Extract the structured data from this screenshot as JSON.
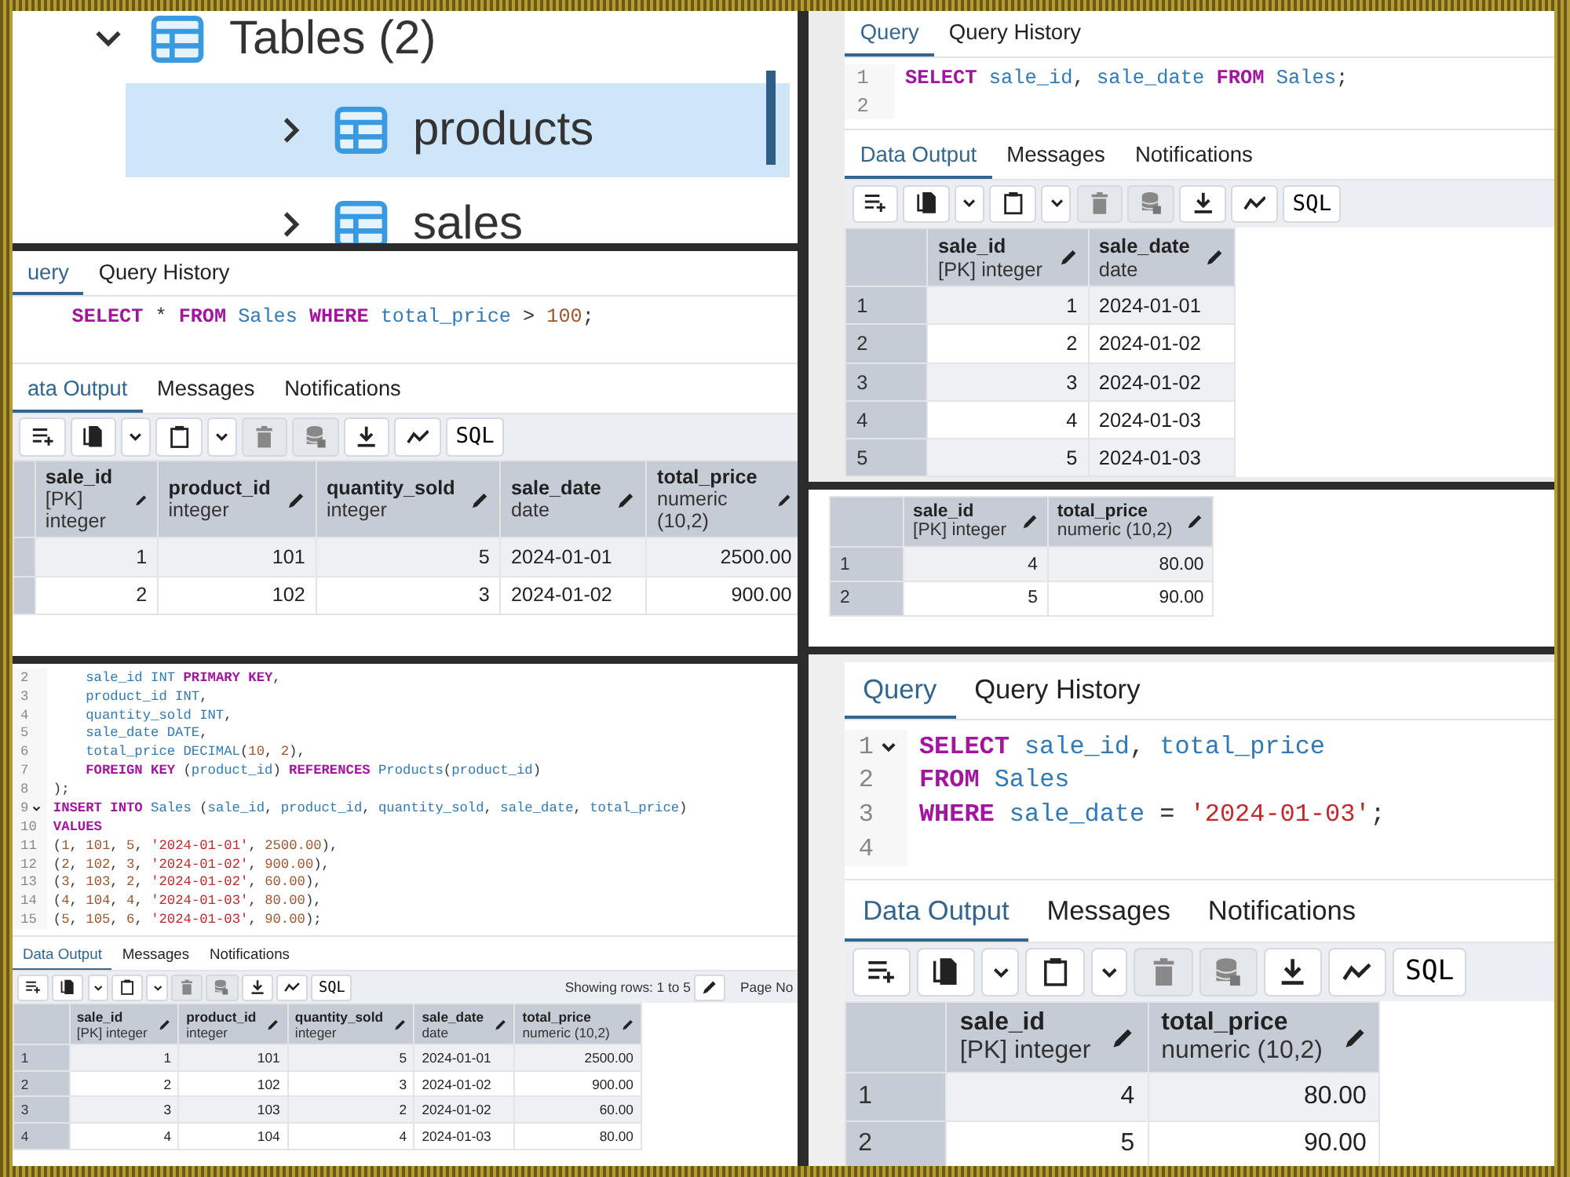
{
  "left_column": {
    "panels": [
      {
        "kind": "tree",
        "nodes": [
          {
            "label": "Tables (2)",
            "expanded": true,
            "selected": false,
            "children": [
              {
                "label": "products",
                "expanded": false,
                "selected": true
              },
              {
                "label": "sales",
                "expanded": false,
                "selected": false
              }
            ]
          }
        ]
      },
      {
        "kind": "query",
        "editor_tabs": [
          {
            "label": "uery",
            "selected": true
          },
          {
            "label": "Query History",
            "selected": false
          }
        ],
        "code": [
          {
            "tokens": [
              {
                "kind": "keyword",
                "text": "SELECT "
              },
              {
                "kind": "plain",
                "text": "* "
              },
              {
                "kind": "keyword",
                "text": "FROM "
              },
              {
                "kind": "name",
                "text": "Sales "
              },
              {
                "kind": "keyword",
                "text": "WHERE "
              },
              {
                "kind": "name",
                "text": "total_price "
              },
              {
                "kind": "plain",
                "text": "> "
              },
              {
                "kind": "number",
                "text": "100"
              },
              {
                "kind": "plain",
                "text": ";"
              }
            ]
          }
        ],
        "output_tabs": [
          {
            "label": "ata Output",
            "selected": true
          },
          {
            "label": "Messages",
            "selected": false
          },
          {
            "label": "Notifications",
            "selected": false
          }
        ],
        "toolbar": [
          {
            "kind": "add-row",
            "disabled": false
          },
          {
            "kind": "copy",
            "disabled": false
          },
          {
            "kind": "menu",
            "disabled": false
          },
          {
            "kind": "paste",
            "disabled": false
          },
          {
            "kind": "menu",
            "disabled": false
          },
          {
            "kind": "delete",
            "disabled": true
          },
          {
            "kind": "save",
            "disabled": true
          },
          {
            "kind": "download",
            "disabled": false
          },
          {
            "kind": "graph",
            "disabled": false
          },
          {
            "kind": "sql",
            "label": "SQL",
            "disabled": false
          }
        ],
        "table": {
          "columns": [
            {
              "name": "sale_id",
              "type": "[PK] integer",
              "right_aligned": true
            },
            {
              "name": "product_id",
              "type": "integer",
              "right_aligned": true
            },
            {
              "name": "quantity_sold",
              "type": "integer",
              "right_aligned": true
            },
            {
              "name": "sale_date",
              "type": "date",
              "right_aligned": false
            },
            {
              "name": "total_price",
              "type": "numeric (10,2)",
              "right_aligned": true
            }
          ],
          "rows": [
            {
              "cells": [
                "1",
                "101",
                "5",
                "2024-01-01",
                "2500.00"
              ]
            },
            {
              "cells": [
                "2",
                "102",
                "3",
                "2024-01-02",
                "900.00"
              ]
            }
          ]
        }
      },
      {
        "kind": "query",
        "code": [
          {
            "number": "2",
            "fold": false,
            "indent": true,
            "tokens": [
              {
                "kind": "name",
                "text": "sale_id INT "
              },
              {
                "kind": "keyword",
                "text": "PRIMARY KEY"
              },
              {
                "kind": "plain",
                "text": ","
              }
            ]
          },
          {
            "number": "3",
            "fold": false,
            "indent": true,
            "tokens": [
              {
                "kind": "name",
                "text": "product_id INT"
              },
              {
                "kind": "plain",
                "text": ","
              }
            ]
          },
          {
            "number": "4",
            "fold": false,
            "indent": true,
            "tokens": [
              {
                "kind": "name",
                "text": "quantity_sold INT"
              },
              {
                "kind": "plain",
                "text": ","
              }
            ]
          },
          {
            "number": "5",
            "fold": false,
            "indent": true,
            "tokens": [
              {
                "kind": "name",
                "text": "sale_date DATE"
              },
              {
                "kind": "plain",
                "text": ","
              }
            ]
          },
          {
            "number": "6",
            "fold": false,
            "indent": true,
            "tokens": [
              {
                "kind": "name",
                "text": "total_price DECIMAL"
              },
              {
                "kind": "plain",
                "text": "("
              },
              {
                "kind": "number",
                "text": "10"
              },
              {
                "kind": "plain",
                "text": ", "
              },
              {
                "kind": "number",
                "text": "2"
              },
              {
                "kind": "plain",
                "text": "),"
              }
            ]
          },
          {
            "number": "7",
            "fold": false,
            "indent": true,
            "tokens": [
              {
                "kind": "keyword",
                "text": "FOREIGN KEY "
              },
              {
                "kind": "plain",
                "text": "("
              },
              {
                "kind": "name",
                "text": "product_id"
              },
              {
                "kind": "plain",
                "text": ") "
              },
              {
                "kind": "keyword",
                "text": "REFERENCES "
              },
              {
                "kind": "name",
                "text": "Products"
              },
              {
                "kind": "plain",
                "text": "("
              },
              {
                "kind": "name",
                "text": "product_id"
              },
              {
                "kind": "plain",
                "text": ")"
              }
            ]
          },
          {
            "number": "8",
            "fold": false,
            "indent": false,
            "tokens": [
              {
                "kind": "plain",
                "text": ");"
              }
            ]
          },
          {
            "number": "9",
            "fold": true,
            "indent": false,
            "tokens": [
              {
                "kind": "keyword",
                "text": "INSERT INTO "
              },
              {
                "kind": "name",
                "text": "Sales "
              },
              {
                "kind": "plain",
                "text": "("
              },
              {
                "kind": "name",
                "text": "sale_id"
              },
              {
                "kind": "plain",
                "text": ", "
              },
              {
                "kind": "name",
                "text": "product_id"
              },
              {
                "kind": "plain",
                "text": ", "
              },
              {
                "kind": "name",
                "text": "quantity_sold"
              },
              {
                "kind": "plain",
                "text": ", "
              },
              {
                "kind": "name",
                "text": "sale_date"
              },
              {
                "kind": "plain",
                "text": ", "
              },
              {
                "kind": "name",
                "text": "total_price"
              },
              {
                "kind": "plain",
                "text": ")"
              }
            ]
          },
          {
            "number": "10",
            "fold": false,
            "indent": false,
            "tokens": [
              {
                "kind": "keyword",
                "text": "VALUES"
              }
            ]
          },
          {
            "number": "11",
            "fold": false,
            "indent": false,
            "tokens": [
              {
                "kind": "plain",
                "text": "("
              },
              {
                "kind": "number",
                "text": "1"
              },
              {
                "kind": "plain",
                "text": ", "
              },
              {
                "kind": "number",
                "text": "101"
              },
              {
                "kind": "plain",
                "text": ", "
              },
              {
                "kind": "number",
                "text": "5"
              },
              {
                "kind": "plain",
                "text": ", "
              },
              {
                "kind": "string",
                "text": "'2024-01-01'"
              },
              {
                "kind": "plain",
                "text": ", "
              },
              {
                "kind": "number",
                "text": "2500.00"
              },
              {
                "kind": "plain",
                "text": "),"
              }
            ]
          },
          {
            "number": "12",
            "fold": false,
            "indent": false,
            "tokens": [
              {
                "kind": "plain",
                "text": "("
              },
              {
                "kind": "number",
                "text": "2"
              },
              {
                "kind": "plain",
                "text": ", "
              },
              {
                "kind": "number",
                "text": "102"
              },
              {
                "kind": "plain",
                "text": ", "
              },
              {
                "kind": "number",
                "text": "3"
              },
              {
                "kind": "plain",
                "text": ", "
              },
              {
                "kind": "string",
                "text": "'2024-01-02'"
              },
              {
                "kind": "plain",
                "text": ", "
              },
              {
                "kind": "number",
                "text": "900.00"
              },
              {
                "kind": "plain",
                "text": "),"
              }
            ]
          },
          {
            "number": "13",
            "fold": false,
            "indent": false,
            "tokens": [
              {
                "kind": "plain",
                "text": "("
              },
              {
                "kind": "number",
                "text": "3"
              },
              {
                "kind": "plain",
                "text": ", "
              },
              {
                "kind": "number",
                "text": "103"
              },
              {
                "kind": "plain",
                "text": ", "
              },
              {
                "kind": "number",
                "text": "2"
              },
              {
                "kind": "plain",
                "text": ", "
              },
              {
                "kind": "string",
                "text": "'2024-01-02'"
              },
              {
                "kind": "plain",
                "text": ", "
              },
              {
                "kind": "number",
                "text": "60.00"
              },
              {
                "kind": "plain",
                "text": "),"
              }
            ]
          },
          {
            "number": "14",
            "fold": false,
            "indent": false,
            "tokens": [
              {
                "kind": "plain",
                "text": "("
              },
              {
                "kind": "number",
                "text": "4"
              },
              {
                "kind": "plain",
                "text": ", "
              },
              {
                "kind": "number",
                "text": "104"
              },
              {
                "kind": "plain",
                "text": ", "
              },
              {
                "kind": "number",
                "text": "4"
              },
              {
                "kind": "plain",
                "text": ", "
              },
              {
                "kind": "string",
                "text": "'2024-01-03'"
              },
              {
                "kind": "plain",
                "text": ", "
              },
              {
                "kind": "number",
                "text": "80.00"
              },
              {
                "kind": "plain",
                "text": "),"
              }
            ]
          },
          {
            "number": "15",
            "fold": false,
            "indent": false,
            "tokens": [
              {
                "kind": "plain",
                "text": "("
              },
              {
                "kind": "number",
                "text": "5"
              },
              {
                "kind": "plain",
                "text": ", "
              },
              {
                "kind": "number",
                "text": "105"
              },
              {
                "kind": "plain",
                "text": ", "
              },
              {
                "kind": "number",
                "text": "6"
              },
              {
                "kind": "plain",
                "text": ", "
              },
              {
                "kind": "string",
                "text": "'2024-01-03'"
              },
              {
                "kind": "plain",
                "text": ", "
              },
              {
                "kind": "number",
                "text": "90.00"
              },
              {
                "kind": "plain",
                "text": ");"
              }
            ]
          }
        ],
        "output_tabs": [
          {
            "label": "Data Output",
            "selected": true
          },
          {
            "label": "Messages",
            "selected": false
          },
          {
            "label": "Notifications",
            "selected": false
          }
        ],
        "toolbar": [
          {
            "kind": "add-row",
            "disabled": false
          },
          {
            "kind": "copy",
            "disabled": false
          },
          {
            "kind": "menu",
            "disabled": false
          },
          {
            "kind": "paste",
            "disabled": false
          },
          {
            "kind": "menu",
            "disabled": false
          },
          {
            "kind": "delete",
            "disabled": true
          },
          {
            "kind": "save",
            "disabled": true
          },
          {
            "kind": "download",
            "disabled": false
          },
          {
            "kind": "graph",
            "disabled": false
          },
          {
            "kind": "sql",
            "label": "SQL",
            "disabled": false
          }
        ],
        "status": "Showing rows: 1 to 5",
        "page_label": "Page No",
        "table": {
          "columns": [
            {
              "name": "sale_id",
              "type": "[PK] integer",
              "right_aligned": true
            },
            {
              "name": "product_id",
              "type": "integer",
              "right_aligned": true
            },
            {
              "name": "quantity_sold",
              "type": "integer",
              "right_aligned": true
            },
            {
              "name": "sale_date",
              "type": "date",
              "right_aligned": false
            },
            {
              "name": "total_price",
              "type": "numeric (10,2)",
              "right_aligned": true
            }
          ],
          "rows": [
            {
              "number": "1",
              "cells": [
                "1",
                "101",
                "5",
                "2024-01-01",
                "2500.00"
              ]
            },
            {
              "number": "2",
              "cells": [
                "2",
                "102",
                "3",
                "2024-01-02",
                "900.00"
              ]
            },
            {
              "number": "3",
              "cells": [
                "3",
                "103",
                "2",
                "2024-01-02",
                "60.00"
              ]
            },
            {
              "number": "4",
              "cells": [
                "4",
                "104",
                "4",
                "2024-01-03",
                "80.00"
              ]
            }
          ]
        }
      }
    ]
  },
  "right_column": {
    "panels": [
      {
        "kind": "query",
        "editor_tabs": [
          {
            "label": "Query",
            "selected": true
          },
          {
            "label": "Query History",
            "selected": false
          }
        ],
        "code": [
          {
            "number": "1",
            "tokens": [
              {
                "kind": "keyword",
                "text": "SELECT "
              },
              {
                "kind": "name",
                "text": "sale_id"
              },
              {
                "kind": "plain",
                "text": ", "
              },
              {
                "kind": "name",
                "text": "sale_date "
              },
              {
                "kind": "keyword",
                "text": "FROM "
              },
              {
                "kind": "name",
                "text": "Sales"
              },
              {
                "kind": "plain",
                "text": ";"
              }
            ]
          },
          {
            "number": "2"
          }
        ],
        "output_tabs": [
          {
            "label": "Data Output",
            "selected": true
          },
          {
            "label": "Messages",
            "selected": false
          },
          {
            "label": "Notifications",
            "selected": false
          }
        ],
        "toolbar": [
          {
            "kind": "add-row",
            "disabled": false
          },
          {
            "kind": "copy",
            "disabled": false
          },
          {
            "kind": "menu",
            "disabled": false
          },
          {
            "kind": "paste",
            "disabled": false
          },
          {
            "kind": "menu",
            "disabled": false
          },
          {
            "kind": "delete",
            "disabled": true
          },
          {
            "kind": "save",
            "disabled": true
          },
          {
            "kind": "download",
            "disabled": false
          },
          {
            "kind": "graph",
            "disabled": false
          },
          {
            "kind": "sql",
            "label": "SQL",
            "disabled": false
          }
        ],
        "table": {
          "columns": [
            {
              "name": "sale_id",
              "type": "[PK] integer",
              "right_aligned": true
            },
            {
              "name": "sale_date",
              "type": "date",
              "right_aligned": false
            }
          ],
          "rows": [
            {
              "number": "1",
              "cells": [
                "1",
                "2024-01-01"
              ]
            },
            {
              "number": "2",
              "cells": [
                "2",
                "2024-01-02"
              ]
            },
            {
              "number": "3",
              "cells": [
                "3",
                "2024-01-02"
              ]
            },
            {
              "number": "4",
              "cells": [
                "4",
                "2024-01-03"
              ]
            },
            {
              "number": "5",
              "cells": [
                "5",
                "2024-01-03"
              ]
            }
          ]
        }
      },
      {
        "kind": "query",
        "table": {
          "columns": [
            {
              "name": "sale_id",
              "type": "[PK] integer",
              "right_aligned": true
            },
            {
              "name": "total_price",
              "type": "numeric (10,2)",
              "right_aligned": true
            }
          ],
          "rows": [
            {
              "number": "1",
              "cells": [
                "4",
                "80.00"
              ]
            },
            {
              "number": "2",
              "cells": [
                "5",
                "90.00"
              ]
            }
          ]
        }
      },
      {
        "kind": "query",
        "editor_tabs": [
          {
            "label": "Query",
            "selected": true
          },
          {
            "label": "Query History",
            "selected": false
          }
        ],
        "code": [
          {
            "number": "1",
            "fold": true,
            "tokens": [
              {
                "kind": "keyword",
                "text": "SELECT "
              },
              {
                "kind": "name",
                "text": "sale_id"
              },
              {
                "kind": "plain",
                "text": ", "
              },
              {
                "kind": "name",
                "text": "total_price"
              }
            ]
          },
          {
            "number": "2",
            "fold": false,
            "tokens": [
              {
                "kind": "keyword",
                "text": "FROM "
              },
              {
                "kind": "name",
                "text": "Sales"
              }
            ]
          },
          {
            "number": "3",
            "fold": false,
            "tokens": [
              {
                "kind": "keyword",
                "text": "WHERE "
              },
              {
                "kind": "name",
                "text": "sale_date "
              },
              {
                "kind": "plain",
                "text": "= "
              },
              {
                "kind": "string",
                "text": "'2024-01-03'"
              },
              {
                "kind": "plain",
                "text": ";"
              }
            ]
          },
          {
            "number": "4",
            "fold": false
          }
        ],
        "output_tabs": [
          {
            "label": "Data Output",
            "selected": true
          },
          {
            "label": "Messages",
            "selected": false
          },
          {
            "label": "Notifications",
            "selected": false
          }
        ],
        "toolbar": [
          {
            "kind": "add-row",
            "disabled": false
          },
          {
            "kind": "copy",
            "disabled": false
          },
          {
            "kind": "menu",
            "disabled": false
          },
          {
            "kind": "paste",
            "disabled": false
          },
          {
            "kind": "menu",
            "disabled": false
          },
          {
            "kind": "delete",
            "disabled": true
          },
          {
            "kind": "save",
            "disabled": true
          },
          {
            "kind": "download",
            "disabled": false
          },
          {
            "kind": "graph",
            "disabled": false
          },
          {
            "kind": "sql",
            "label": "SQL",
            "disabled": false
          }
        ],
        "table": {
          "columns": [
            {
              "name": "sale_id",
              "type": "[PK] integer",
              "right_aligned": true
            },
            {
              "name": "total_price",
              "type": "numeric (10,2)",
              "right_aligned": true
            }
          ],
          "rows": [
            {
              "number": "1",
              "cells": [
                "4",
                "80.00"
              ]
            },
            {
              "number": "2",
              "cells": [
                "5",
                "90.00"
              ]
            }
          ]
        }
      }
    ]
  }
}
